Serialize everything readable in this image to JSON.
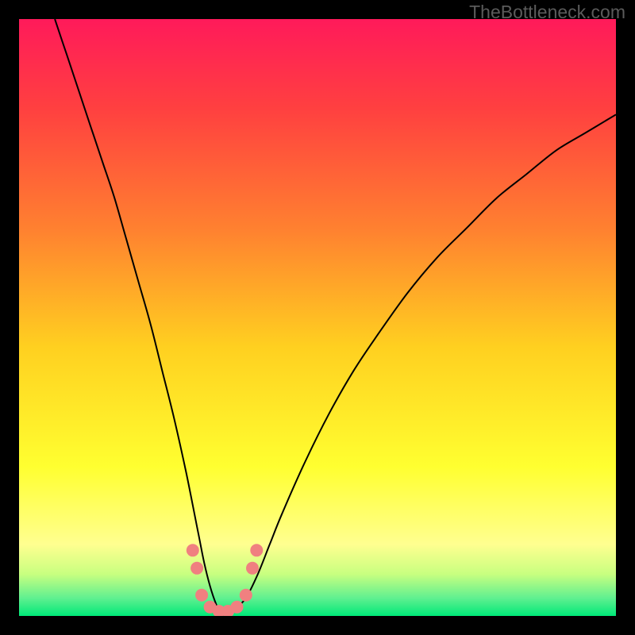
{
  "watermark": "TheBottleneck.com",
  "chart_data": {
    "type": "line",
    "title": "",
    "xlabel": "",
    "ylabel": "",
    "xlim": [
      0,
      100
    ],
    "ylim": [
      0,
      100
    ],
    "grid": false,
    "legend": false,
    "background": {
      "type": "vertical-gradient",
      "stops": [
        {
          "pos": 0.0,
          "color": "#ff1a5a"
        },
        {
          "pos": 0.15,
          "color": "#ff4040"
        },
        {
          "pos": 0.35,
          "color": "#ff8030"
        },
        {
          "pos": 0.55,
          "color": "#ffd020"
        },
        {
          "pos": 0.75,
          "color": "#ffff30"
        },
        {
          "pos": 0.88,
          "color": "#ffff90"
        },
        {
          "pos": 0.93,
          "color": "#c8ff80"
        },
        {
          "pos": 0.97,
          "color": "#60f090"
        },
        {
          "pos": 1.0,
          "color": "#00e878"
        }
      ]
    },
    "series": [
      {
        "name": "bottleneck-curve",
        "stroke": "#000000",
        "stroke_width": 2,
        "x": [
          6,
          8,
          10,
          12,
          14,
          16,
          18,
          20,
          22,
          24,
          26,
          28,
          30,
          31,
          32,
          33,
          34,
          35,
          36,
          38,
          40,
          42,
          44,
          48,
          52,
          56,
          60,
          65,
          70,
          75,
          80,
          85,
          90,
          95,
          100
        ],
        "y": [
          100,
          94,
          88,
          82,
          76,
          70,
          63,
          56,
          49,
          41,
          33,
          24,
          14,
          9,
          5,
          2,
          0,
          0,
          1,
          3,
          7,
          12,
          17,
          26,
          34,
          41,
          47,
          54,
          60,
          65,
          70,
          74,
          78,
          81,
          84
        ]
      }
    ],
    "markers": {
      "name": "valley-points",
      "color": "#f08080",
      "radius": 8,
      "points": [
        {
          "x": 29.1,
          "y": 11
        },
        {
          "x": 29.8,
          "y": 8
        },
        {
          "x": 30.6,
          "y": 3.5
        },
        {
          "x": 32.0,
          "y": 1.5
        },
        {
          "x": 33.5,
          "y": 0.8
        },
        {
          "x": 35.0,
          "y": 0.8
        },
        {
          "x": 36.5,
          "y": 1.5
        },
        {
          "x": 38.0,
          "y": 3.5
        },
        {
          "x": 39.1,
          "y": 8
        },
        {
          "x": 39.8,
          "y": 11
        }
      ]
    }
  }
}
